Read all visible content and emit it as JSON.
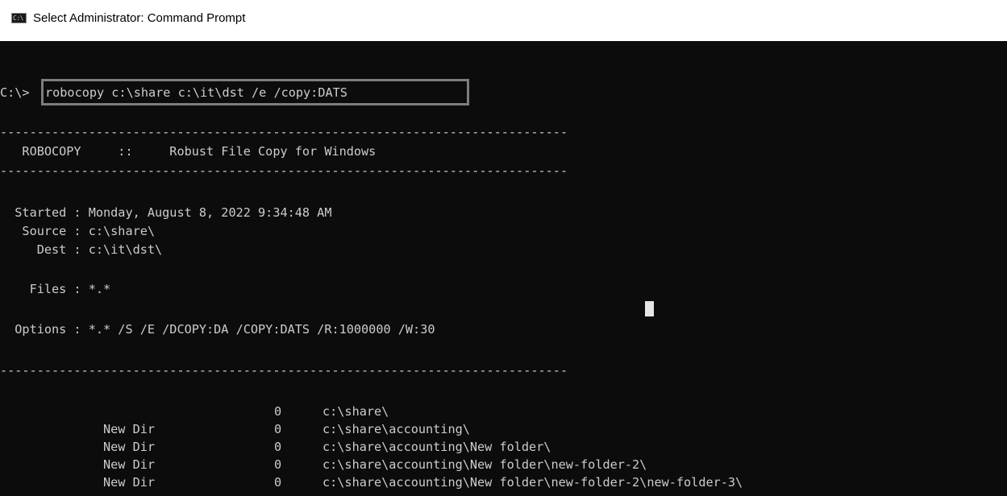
{
  "window": {
    "title": "Select Administrator: Command Prompt",
    "icon_text": "C:\\"
  },
  "console": {
    "prompt": "C:\\>",
    "command": "robocopy c:\\share c:\\it\\dst /e /copy:DATS",
    "separator": "-----------------------------------------------------------------------------",
    "header": "   ROBOCOPY     ::     Robust File Copy for Windows",
    "started": "  Started : Monday, August 8, 2022 9:34:48 AM",
    "source": "   Source : c:\\share\\",
    "dest": "     Dest : c:\\it\\dst\\",
    "files": "    Files : *.*",
    "options": "  Options : *.* /S /E /DCOPY:DA /COPY:DATS /R:1000000 /W:30",
    "rows": [
      {
        "status": "",
        "count": "0",
        "path": "c:\\share\\"
      },
      {
        "status": "New Dir",
        "count": "0",
        "path": "c:\\share\\accounting\\"
      },
      {
        "status": "New Dir",
        "count": "0",
        "path": "c:\\share\\accounting\\New folder\\"
      },
      {
        "status": "New Dir",
        "count": "0",
        "path": "c:\\share\\accounting\\New folder\\new-folder-2\\"
      },
      {
        "status": "New Dir",
        "count": "0",
        "path": "c:\\share\\accounting\\New folder\\new-folder-2\\new-folder-3\\"
      }
    ]
  }
}
